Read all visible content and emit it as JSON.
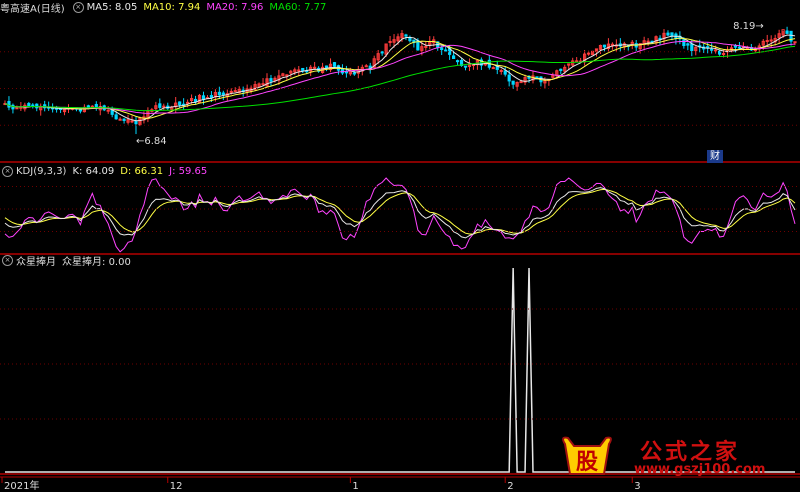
{
  "colors": {
    "up": "#ff3c3c",
    "down": "#00d7ff",
    "ma5": "#e8e8e8",
    "ma10": "#ffff44",
    "ma20": "#ff44ff",
    "ma60": "#00e000",
    "kdj_k": "#e8e8e8",
    "kdj_d": "#ffff44",
    "kdj_j": "#ff44ff",
    "panel_border": "#b40000",
    "grid": "#6e0000",
    "axis_text": "#ddd"
  },
  "header": {
    "stock": "粤高速A(日线)",
    "ma5_label": "MA5:",
    "ma5": "8.05",
    "ma10_label": "MA10:",
    "ma10": "7.94",
    "ma20_label": "MA20:",
    "ma20": "7.96",
    "ma60_label": "MA60:",
    "ma60": "7.77"
  },
  "kdj_header": {
    "name": "KDJ(9,3,3)",
    "k_label": "K:",
    "k": "64.09",
    "d_label": "D:",
    "d": "66.31",
    "j_label": "J:",
    "j": "59.65"
  },
  "ind_header": {
    "name": "众星捧月",
    "series_label": "众星捧月:",
    "value": "0.00"
  },
  "icons": {
    "collapse": "circle-x-icon"
  },
  "badge": "财",
  "watermark": {
    "brand": "股",
    "cn": "公式之家",
    "url": "www.gszj100.com"
  },
  "chart_data": [
    {
      "type": "candlestick",
      "title": "粤高速A(日线)",
      "n": 200,
      "ylim": [
        6.5,
        8.4
      ],
      "annotations": [
        {
          "label": "6.84",
          "kind": "low"
        },
        {
          "label": "8.19",
          "kind": "high"
        }
      ],
      "close_anchors": [
        [
          0,
          7.2
        ],
        [
          8,
          7.18
        ],
        [
          16,
          7.15
        ],
        [
          22,
          7.2
        ],
        [
          28,
          7.08
        ],
        [
          32,
          6.98
        ],
        [
          38,
          7.18
        ],
        [
          44,
          7.25
        ],
        [
          50,
          7.32
        ],
        [
          56,
          7.4
        ],
        [
          62,
          7.45
        ],
        [
          66,
          7.55
        ],
        [
          70,
          7.62
        ],
        [
          74,
          7.7
        ],
        [
          78,
          7.68
        ],
        [
          82,
          7.75
        ],
        [
          86,
          7.65
        ],
        [
          92,
          7.72
        ],
        [
          96,
          8.0
        ],
        [
          100,
          8.15
        ],
        [
          104,
          7.95
        ],
        [
          108,
          8.05
        ],
        [
          112,
          7.88
        ],
        [
          116,
          7.72
        ],
        [
          120,
          7.78
        ],
        [
          124,
          7.68
        ],
        [
          128,
          7.52
        ],
        [
          132,
          7.6
        ],
        [
          136,
          7.55
        ],
        [
          140,
          7.7
        ],
        [
          144,
          7.78
        ],
        [
          148,
          7.92
        ],
        [
          152,
          8.05
        ],
        [
          156,
          8.02
        ],
        [
          160,
          8.0
        ],
        [
          164,
          8.1
        ],
        [
          168,
          8.15
        ],
        [
          172,
          7.98
        ],
        [
          176,
          7.95
        ],
        [
          180,
          7.9
        ],
        [
          184,
          8.0
        ],
        [
          188,
          7.95
        ],
        [
          192,
          8.05
        ],
        [
          196,
          8.19
        ],
        [
          199,
          8.05
        ]
      ],
      "series": [
        {
          "name": "MA5"
        },
        {
          "name": "MA10"
        },
        {
          "name": "MA20"
        },
        {
          "name": "MA60"
        }
      ]
    },
    {
      "type": "line",
      "title": "KDJ(9,3,3)",
      "ylim": [
        -10,
        110
      ],
      "series": [
        {
          "name": "K"
        },
        {
          "name": "D"
        },
        {
          "name": "J"
        }
      ]
    },
    {
      "type": "line",
      "title": "众星捧月",
      "ylim": [
        0,
        1
      ],
      "series": [
        {
          "name": "众星捧月",
          "spikes": [
            {
              "start": 127,
              "end": 129,
              "value": 1
            },
            {
              "start": 131,
              "end": 133,
              "value": 1
            }
          ]
        }
      ]
    }
  ],
  "x_axis": {
    "ticks": [
      {
        "index": 0,
        "label": "2021年"
      },
      {
        "index": 41,
        "label": "12"
      },
      {
        "index": 87,
        "label": "1"
      },
      {
        "index": 126,
        "label": "2"
      },
      {
        "index": 158,
        "label": "3"
      }
    ]
  }
}
